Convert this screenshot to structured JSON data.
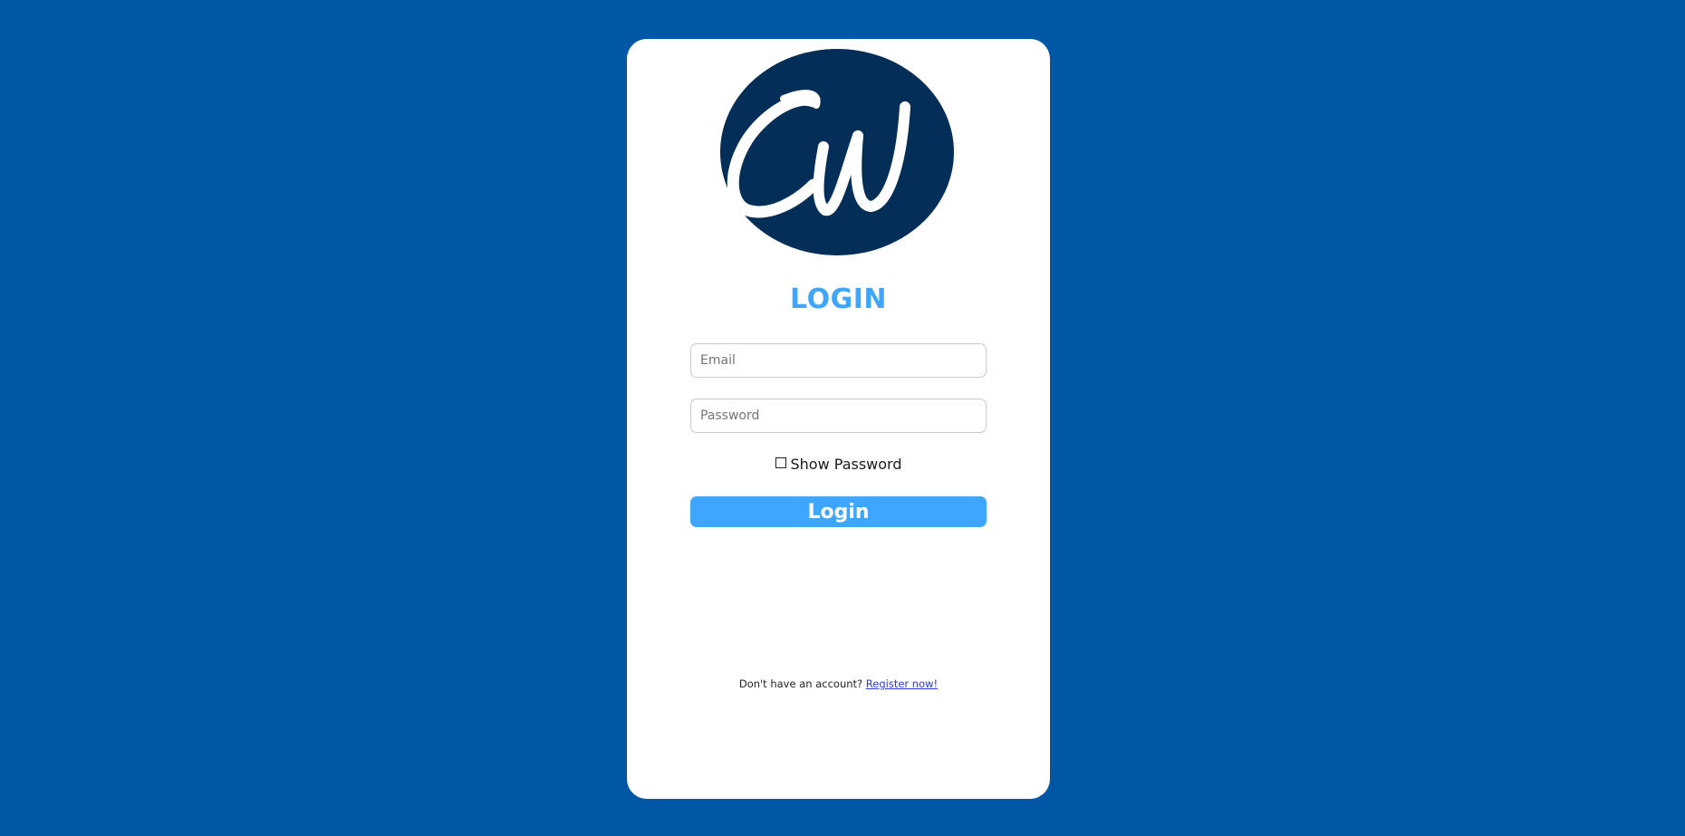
{
  "login_card": {
    "logo": {
      "text": "CW",
      "icon": "cw-logo",
      "circle_color": "#022e57",
      "letter_color": "#ffffff"
    },
    "title": "LOGIN",
    "email": {
      "value": "",
      "placeholder": "Email"
    },
    "password": {
      "value": "",
      "placeholder": "Password"
    },
    "show_password": {
      "label": "Show Password",
      "checked": false
    },
    "login_button": {
      "label": "Login"
    },
    "footer": {
      "text": "Don't have an account?",
      "link_text": "Register now!"
    }
  },
  "colors": {
    "background": "#0057a5",
    "card": "#ffffff",
    "accent": "#3ea6ff",
    "logo_circle": "#022e57",
    "link": "#2a3bd6"
  }
}
